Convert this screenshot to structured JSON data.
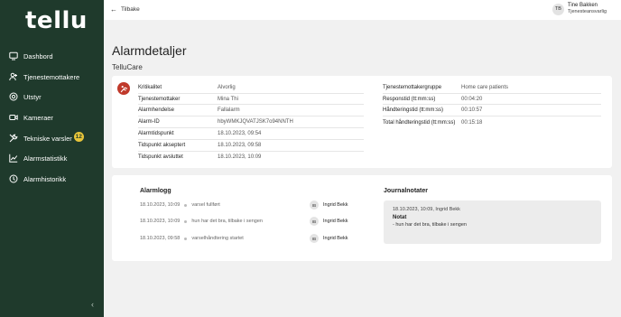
{
  "app": {
    "logo": "tellu"
  },
  "sidebar": {
    "items": [
      {
        "label": "Dashbord",
        "icon": "dashboard-icon"
      },
      {
        "label": "Tjenestemottakere",
        "icon": "users-icon"
      },
      {
        "label": "Utstyr",
        "icon": "device-icon"
      },
      {
        "label": "Kameraer",
        "icon": "camera-icon"
      },
      {
        "label": "Tekniske varsler",
        "icon": "wrench-icon",
        "badge": "12"
      },
      {
        "label": "Alarmstatistikk",
        "icon": "chart-icon"
      },
      {
        "label": "Alarmhistorikk",
        "icon": "clock-icon"
      }
    ],
    "collapse_glyph": "‹"
  },
  "topbar": {
    "back_label": "Tilbake",
    "user": {
      "initials": "TB",
      "name": "Tine Bakken",
      "role": "Tjenesteansvarlig"
    }
  },
  "page": {
    "title": "Alarmdetaljer",
    "subtitle": "TelluCare"
  },
  "details": {
    "left": [
      {
        "key": "Kritikalitet",
        "value": "Alvorlig"
      },
      {
        "key": "Tjenestemottaker",
        "value": "Mina Thi"
      },
      {
        "key": "Alarmhendelse",
        "value": "Fallalarm"
      },
      {
        "key": "Alarm-ID",
        "value": "hbyWMKJQVATJSK7o94NNTH"
      },
      {
        "key": "Alarmtidspunkt",
        "value": "18.10.2023, 09:54"
      },
      {
        "key": "Tidspunkt akseptert",
        "value": "18.10.2023, 09:58"
      },
      {
        "key": "Tidspunkt avsluttet",
        "value": "18.10.2023, 10:09"
      }
    ],
    "right": [
      {
        "key": "Tjenestemottakergruppe",
        "value": "Home care patients"
      },
      {
        "key": "Responstid (tt:mm:ss)",
        "value": "00:04:20"
      },
      {
        "key": "Håndteringstid (tt:mm:ss)",
        "value": "00:10:57"
      },
      {
        "key": "Total håndteringstid (tt:mm:ss)",
        "value": "00:15:18"
      }
    ],
    "alarm_color": "#c0392b"
  },
  "alarmlogg": {
    "title": "Alarmlogg",
    "entries": [
      {
        "time": "18.10.2023, 10:09",
        "text": "varsel fullført",
        "initials": "IB",
        "user": "Ingrid Bekk"
      },
      {
        "time": "18.10.2023, 10:09",
        "text": "hun har det bra, tilbake i sengen",
        "initials": "IB",
        "user": "Ingrid Bekk"
      },
      {
        "time": "18.10.2023, 09:58",
        "text": "varselhåndtering startet",
        "initials": "IB",
        "user": "Ingrid Bekk"
      }
    ]
  },
  "journal": {
    "title": "Journalnotater",
    "entry": {
      "time": "18.10.2023, 10:09",
      "user": "Ingrid Bekk",
      "label": "Notat",
      "text": "- hun har det bra, tilbake i sengen"
    }
  }
}
